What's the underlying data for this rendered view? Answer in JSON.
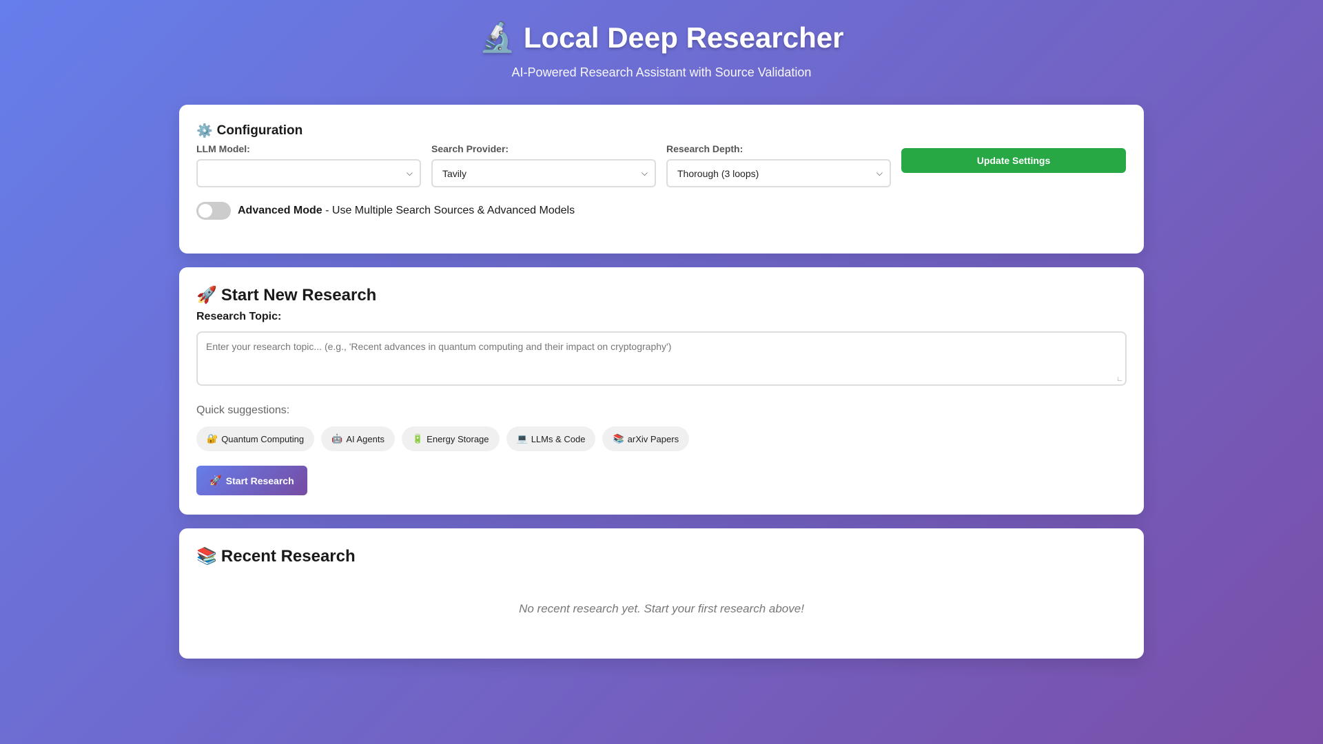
{
  "header": {
    "title_icon": "🔬",
    "title": "Local Deep Researcher",
    "subtitle": "AI-Powered Research Assistant with Source Validation"
  },
  "config": {
    "icon": "⚙️",
    "heading": "Configuration",
    "llm_label": "LLM Model:",
    "llm_value": "",
    "provider_label": "Search Provider:",
    "provider_value": "Tavily",
    "depth_label": "Research Depth:",
    "depth_value": "Thorough (3 loops)",
    "update_label": "Update Settings",
    "advanced_bold": "Advanced Mode",
    "advanced_rest": " - Use Multiple Search Sources & Advanced Models",
    "advanced_on": false
  },
  "research": {
    "icon": "🚀",
    "heading": "Start New Research",
    "topic_label": "Research Topic:",
    "topic_placeholder": "Enter your research topic... (e.g., 'Recent advances in quantum computing and their impact on cryptography')",
    "quick_label": "Quick suggestions:",
    "chips": [
      {
        "icon": "🔐",
        "label": "Quantum Computing"
      },
      {
        "icon": "🤖",
        "label": "AI Agents"
      },
      {
        "icon": "🔋",
        "label": "Energy Storage"
      },
      {
        "icon": "💻",
        "label": "LLMs & Code"
      },
      {
        "icon": "📚",
        "label": "arXiv Papers"
      }
    ],
    "start_icon": "🚀",
    "start_label": "Start Research"
  },
  "recent": {
    "icon": "📚",
    "heading": "Recent Research",
    "empty_text": "No recent research yet. Start your first research above!"
  }
}
